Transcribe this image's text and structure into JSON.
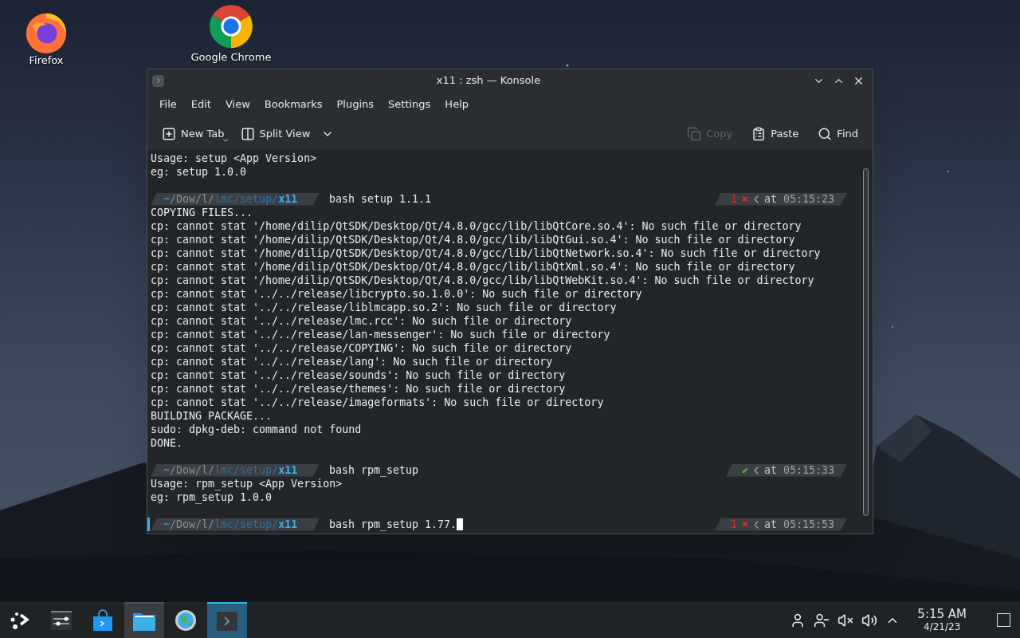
{
  "desktop_icons": [
    {
      "label": "Firefox",
      "kind": "firefox"
    },
    {
      "label": "Google Chrome",
      "kind": "chrome"
    }
  ],
  "window": {
    "title": "x11 : zsh — Konsole",
    "menu": [
      "File",
      "Edit",
      "View",
      "Bookmarks",
      "Plugins",
      "Settings",
      "Help"
    ],
    "toolbar": {
      "left": [
        {
          "label": "New Tab",
          "kind": "new-tab",
          "disabled": false
        },
        {
          "label": "Split View",
          "kind": "split-view",
          "disabled": false
        }
      ],
      "right": [
        {
          "label": "Copy",
          "kind": "copy",
          "disabled": true
        },
        {
          "label": "Paste",
          "kind": "paste",
          "disabled": false
        },
        {
          "label": "Find",
          "kind": "find",
          "disabled": false
        }
      ]
    },
    "terminal": {
      "lines": [
        {
          "kind": "output",
          "text": "Usage: setup <App Version>"
        },
        {
          "kind": "output",
          "text": "eg: setup 1.0.0"
        },
        {
          "kind": "blank"
        },
        {
          "kind": "prompt",
          "path": [
            {
              "text": "~",
              "kind": "home"
            },
            {
              "text": "/Dow/l/",
              "kind": "dim"
            },
            {
              "text": "lmc/setup/",
              "kind": "dir"
            },
            {
              "text": "x11",
              "kind": "current"
            }
          ],
          "command": "bash setup 1.1.1",
          "status": {
            "ok": false,
            "code": "1",
            "mark": "✖"
          },
          "time_prefix": "at",
          "time": "05:15:23",
          "cursor": false
        },
        {
          "kind": "output",
          "text": "COPYING FILES..."
        },
        {
          "kind": "output",
          "text": "cp: cannot stat '/home/dilip/QtSDK/Desktop/Qt/4.8.0/gcc/lib/libQtCore.so.4': No such file or directory"
        },
        {
          "kind": "output",
          "text": "cp: cannot stat '/home/dilip/QtSDK/Desktop/Qt/4.8.0/gcc/lib/libQtGui.so.4': No such file or directory"
        },
        {
          "kind": "output",
          "text": "cp: cannot stat '/home/dilip/QtSDK/Desktop/Qt/4.8.0/gcc/lib/libQtNetwork.so.4': No such file or directory"
        },
        {
          "kind": "output",
          "text": "cp: cannot stat '/home/dilip/QtSDK/Desktop/Qt/4.8.0/gcc/lib/libQtXml.so.4': No such file or directory"
        },
        {
          "kind": "output",
          "text": "cp: cannot stat '/home/dilip/QtSDK/Desktop/Qt/4.8.0/gcc/lib/libQtWebKit.so.4': No such file or directory"
        },
        {
          "kind": "output",
          "text": "cp: cannot stat '../../release/libcrypto.so.1.0.0': No such file or directory"
        },
        {
          "kind": "output",
          "text": "cp: cannot stat '../../release/liblmcapp.so.2': No such file or directory"
        },
        {
          "kind": "output",
          "text": "cp: cannot stat '../../release/lmc.rcc': No such file or directory"
        },
        {
          "kind": "output",
          "text": "cp: cannot stat '../../release/lan-messenger': No such file or directory"
        },
        {
          "kind": "output",
          "text": "cp: cannot stat '../../release/COPYING': No such file or directory"
        },
        {
          "kind": "output",
          "text": "cp: cannot stat '../../release/lang': No such file or directory"
        },
        {
          "kind": "output",
          "text": "cp: cannot stat '../../release/sounds': No such file or directory"
        },
        {
          "kind": "output",
          "text": "cp: cannot stat '../../release/themes': No such file or directory"
        },
        {
          "kind": "output",
          "text": "cp: cannot stat '../../release/imageformats': No such file or directory"
        },
        {
          "kind": "output",
          "text": "BUILDING PACKAGE..."
        },
        {
          "kind": "output",
          "text": "sudo: dpkg-deb: command not found"
        },
        {
          "kind": "output",
          "text": "DONE."
        },
        {
          "kind": "blank"
        },
        {
          "kind": "prompt",
          "path": [
            {
              "text": "~",
              "kind": "home"
            },
            {
              "text": "/Dow/l/",
              "kind": "dim"
            },
            {
              "text": "lmc/setup/",
              "kind": "dir"
            },
            {
              "text": "x11",
              "kind": "current"
            }
          ],
          "command": "bash rpm_setup",
          "status": {
            "ok": true,
            "mark": "✔"
          },
          "time_prefix": "at",
          "time": "05:15:33",
          "cursor": false
        },
        {
          "kind": "output",
          "text": "Usage: rpm_setup <App Version>"
        },
        {
          "kind": "output",
          "text": "eg: rpm_setup 1.0.0"
        },
        {
          "kind": "blank"
        },
        {
          "kind": "prompt",
          "path": [
            {
              "text": "~",
              "kind": "home"
            },
            {
              "text": "/Dow/l/",
              "kind": "dim"
            },
            {
              "text": "lmc/setup/",
              "kind": "dir"
            },
            {
              "text": "x11",
              "kind": "current"
            }
          ],
          "command": "bash rpm_setup 1.77.",
          "status": {
            "ok": false,
            "code": "1",
            "mark": "✖"
          },
          "time_prefix": "at",
          "time": "05:15:53",
          "cursor": true
        }
      ]
    }
  },
  "taskbar": {
    "apps": [
      {
        "kind": "launcher",
        "selected": false,
        "hovered": false
      },
      {
        "kind": "system-settings",
        "selected": false,
        "hovered": false
      },
      {
        "kind": "store",
        "selected": false,
        "hovered": false
      },
      {
        "kind": "files",
        "selected": false,
        "hovered": true
      },
      {
        "kind": "globe",
        "selected": false,
        "hovered": false
      },
      {
        "kind": "terminal",
        "selected": true,
        "hovered": false
      }
    ],
    "clock": {
      "time": "5:15 AM",
      "date": "4/21/23"
    }
  }
}
